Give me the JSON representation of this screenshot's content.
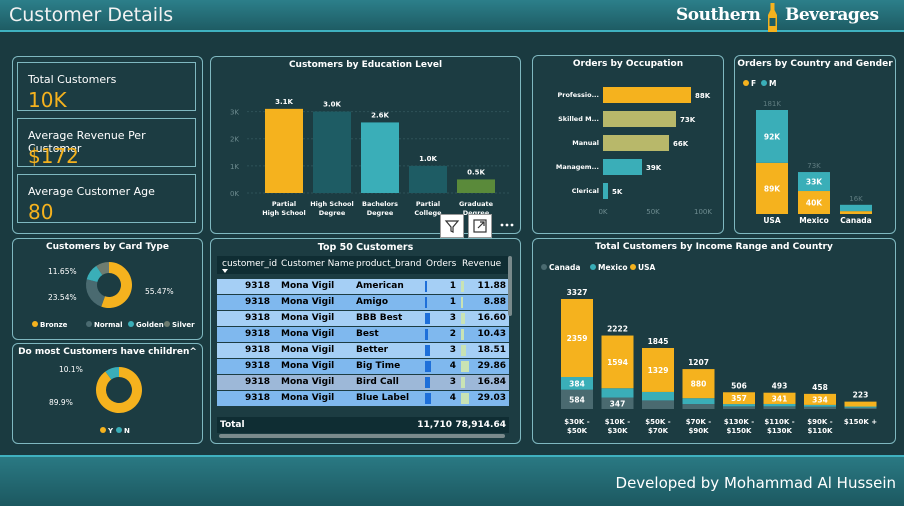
{
  "header": {
    "title": "Customer Details",
    "logo_left": "Southern",
    "logo_right": "Beverages"
  },
  "footer": {
    "credit": "Developed by Mohammad Al Hussein"
  },
  "kpis": [
    {
      "label": "Total Customers",
      "value": "10K"
    },
    {
      "label": "Average Revenue Per Customer",
      "value": "$172"
    },
    {
      "label": "Average Customer Age",
      "value": "80"
    }
  ],
  "colors": {
    "gold": "#f5b21e",
    "teal": "#3aaeb8",
    "dark_teal": "#1e5c64",
    "slate": "#4a6a70",
    "green": "#5a8a3a",
    "olive": "#b8b86a"
  },
  "chart_data": [
    {
      "type": "bar",
      "title": "Customers by Education Level",
      "categories": [
        "Partial High School",
        "High School Degree",
        "Bachelors Degree",
        "Partial College",
        "Graduate Degree"
      ],
      "values": [
        3100,
        3000,
        2600,
        1000,
        500
      ],
      "data_labels": [
        "3.1K",
        "3.0K",
        "2.6K",
        "1.0K",
        "0.5K"
      ],
      "yticks": [
        "0K",
        "1K",
        "2K",
        "3K"
      ],
      "ylim": [
        0,
        3500
      ]
    },
    {
      "type": "bar",
      "title": "Orders by Occupation",
      "orientation": "horizontal",
      "categories": [
        "Professio...",
        "Skilled M...",
        "Manual",
        "Managem...",
        "Clerical"
      ],
      "values": [
        88000,
        73000,
        66000,
        39000,
        5000
      ],
      "data_labels": [
        "88K",
        "73K",
        "66K",
        "39K",
        "5K"
      ],
      "xticks": [
        "0K",
        "50K",
        "100K"
      ],
      "xlim": [
        0,
        100000
      ]
    },
    {
      "type": "bar",
      "title": "Orders by Country and Gender",
      "stacked": true,
      "categories": [
        "USA",
        "Mexico",
        "Canada"
      ],
      "series": [
        {
          "name": "F",
          "values": [
            89000,
            40000,
            5000
          ],
          "labels": [
            "89K",
            "40K",
            ""
          ]
        },
        {
          "name": "M",
          "values": [
            92000,
            33000,
            11000
          ],
          "labels": [
            "92K",
            "33K",
            ""
          ]
        }
      ],
      "totals": [
        "181K",
        "73K",
        "16K"
      ],
      "legend": "top-left"
    },
    {
      "type": "pie",
      "title": "Customers by Card Type",
      "series_names": [
        "Bronze",
        "Normal",
        "Golden",
        "Silver"
      ],
      "values": [
        55.47,
        23.54,
        11.65,
        9.34
      ],
      "labels": [
        "55.47%",
        "23.54%",
        "11.65%",
        ""
      ],
      "legend": "bottom"
    },
    {
      "type": "pie",
      "title": "Do most Customers have children^",
      "series_names": [
        "Y",
        "N"
      ],
      "values": [
        89.9,
        10.1
      ],
      "labels": [
        "89.9%",
        "10.1%"
      ],
      "legend": "bottom"
    },
    {
      "type": "bar",
      "title": "Total Customers by Income Range and Country",
      "stacked": true,
      "categories": [
        "$30K - $50K",
        "$10K - $30K",
        "$50K - $70K",
        "$70K - $90K",
        "$130K - $150K",
        "$110K - $130K",
        "$90K - $110K",
        "$150K +"
      ],
      "series": [
        {
          "name": "Canada",
          "values": [
            584,
            347,
            260,
            150,
            80,
            80,
            70,
            40
          ],
          "labels": [
            "584",
            "347",
            "",
            "",
            "",
            "",
            "",
            ""
          ]
        },
        {
          "name": "Mexico",
          "values": [
            384,
            281,
            256,
            177,
            69,
            72,
            54,
            34
          ],
          "labels": [
            "384",
            "",
            "",
            "",
            "",
            "",
            "",
            ""
          ]
        },
        {
          "name": "USA",
          "values": [
            2359,
            1594,
            1329,
            880,
            357,
            341,
            334,
            149
          ],
          "labels": [
            "2359",
            "1594",
            "1329",
            "880",
            "357",
            "341",
            "334",
            ""
          ]
        }
      ],
      "totals": [
        "3327",
        "2222",
        "1845",
        "1207",
        "506",
        "493",
        "458",
        "223"
      ],
      "legend": "top-left"
    },
    {
      "type": "table",
      "title": "Top 50 Customers",
      "columns": [
        "customer_id",
        "Customer Name",
        "product_brand",
        "Orders",
        "Revenue"
      ],
      "rows": [
        [
          "9318",
          "Mona Vigil",
          "American",
          "1",
          "11.88"
        ],
        [
          "9318",
          "Mona Vigil",
          "Amigo",
          "1",
          "8.88"
        ],
        [
          "9318",
          "Mona Vigil",
          "BBB Best",
          "3",
          "16.60"
        ],
        [
          "9318",
          "Mona Vigil",
          "Best",
          "2",
          "10.43"
        ],
        [
          "9318",
          "Mona Vigil",
          "Better",
          "3",
          "18.51"
        ],
        [
          "9318",
          "Mona Vigil",
          "Big Time",
          "4",
          "29.86"
        ],
        [
          "9318",
          "Mona Vigil",
          "Bird Call",
          "3",
          "16.84"
        ],
        [
          "9318",
          "Mona Vigil",
          "Blue Label",
          "4",
          "29.03"
        ]
      ],
      "total_label": "Total",
      "total_orders": "11,710",
      "total_revenue": "78,914.64"
    }
  ]
}
